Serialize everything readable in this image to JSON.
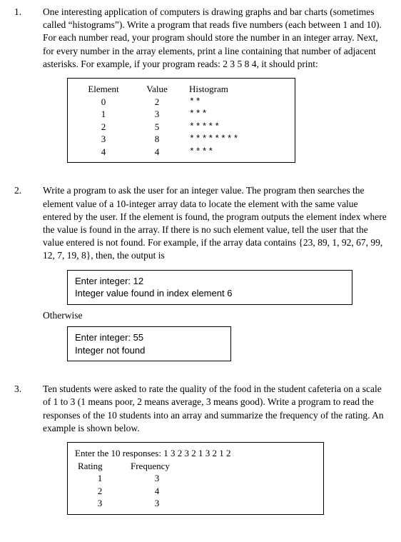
{
  "problems": [
    {
      "number": "1.",
      "text": "One interesting application of computers is drawing graphs and bar charts (sometimes called “histograms”). Write a program that reads five numbers (each between 1 and 10). For each number read, your program should store the number in an integer array. Next, for every number in the array elements, print a line containing that number of adjacent asterisks. For example, if your program reads: 2 3 5 8 4, it should print:",
      "histogram": {
        "headers": [
          "Element",
          "Value",
          "Histogram"
        ],
        "rows": [
          {
            "element": "0",
            "value": "2",
            "bar": "**"
          },
          {
            "element": "1",
            "value": "3",
            "bar": "***"
          },
          {
            "element": "2",
            "value": "5",
            "bar": "*****"
          },
          {
            "element": "3",
            "value": "8",
            "bar": "********"
          },
          {
            "element": "4",
            "value": "4",
            "bar": "****"
          }
        ]
      }
    },
    {
      "number": "2.",
      "text": "Write a program to ask the user for an integer value. The program then searches the element value of a 10-integer array data to locate the element with the same value entered by the user. If the element is found, the program outputs the element index where the value is found in the array. If there is no such element value, tell the user that the value entered is not found. For example, if the array data contains {23, 89, 1, 92, 67, 99, 12, 7, 19, 8}, then, the output is",
      "sample1": {
        "line1": "Enter integer: 12",
        "line2": "Integer value found in index element  6"
      },
      "otherwise": "Otherwise",
      "sample2": {
        "line1": "Enter integer: 55",
        "line2": "Integer not found"
      }
    },
    {
      "number": "3.",
      "text": "Ten students were asked to rate the quality of the food in the student cafeteria on a scale of 1 to 3 (1 means poor, 2 means average, 3 means good). Write a program to read the responses of the 10 students into an array and summarize the frequency of the rating. An example is shown below.",
      "rating": {
        "input_line": "Enter the 10 responses: 1 3 2 3 2 1 3 2 1 2",
        "headers": [
          "Rating",
          "Frequency"
        ],
        "rows": [
          {
            "rating": "1",
            "freq": "3"
          },
          {
            "rating": "2",
            "freq": "4"
          },
          {
            "rating": "3",
            "freq": "3"
          }
        ]
      }
    }
  ]
}
